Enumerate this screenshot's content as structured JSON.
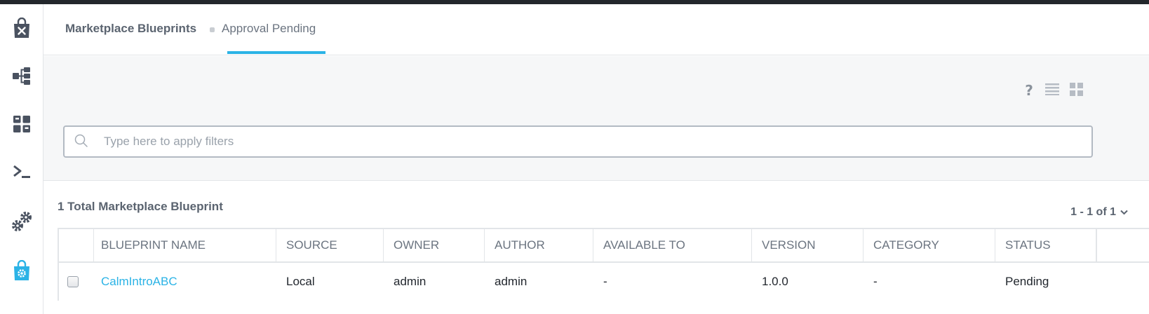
{
  "sidebar": {
    "items": [
      {
        "icon": "marketplace-bag-icon"
      },
      {
        "icon": "blueprints-icon"
      },
      {
        "icon": "applications-grid-icon"
      },
      {
        "icon": "runbooks-terminal-icon"
      },
      {
        "icon": "settings-gears-icon"
      },
      {
        "icon": "marketplace-manager-icon",
        "active": true
      }
    ]
  },
  "tabs": {
    "items": [
      {
        "label": "Marketplace Blueprints"
      },
      {
        "label": "Approval Pending",
        "active": true
      }
    ]
  },
  "toolbar": {
    "help_icon": "?",
    "list_view_icon": "list-view-icon",
    "grid_view_icon": "grid-view-icon"
  },
  "search": {
    "placeholder": "Type here to apply filters",
    "value": ""
  },
  "summary": {
    "count_text": "1 Total Marketplace Blueprint",
    "pagination": "1 - 1 of 1"
  },
  "table": {
    "columns": [
      "BLUEPRINT NAME",
      "SOURCE",
      "OWNER",
      "AUTHOR",
      "AVAILABLE TO",
      "VERSION",
      "CATEGORY",
      "STATUS"
    ],
    "rows": [
      [
        "CalmIntroABC",
        "Local",
        "admin",
        "admin",
        "-",
        "1.0.0",
        "-",
        "Pending"
      ]
    ]
  },
  "colors": {
    "accent": "#2bb3e6",
    "topbar": "#23272c",
    "muted_text": "#6b7480"
  }
}
